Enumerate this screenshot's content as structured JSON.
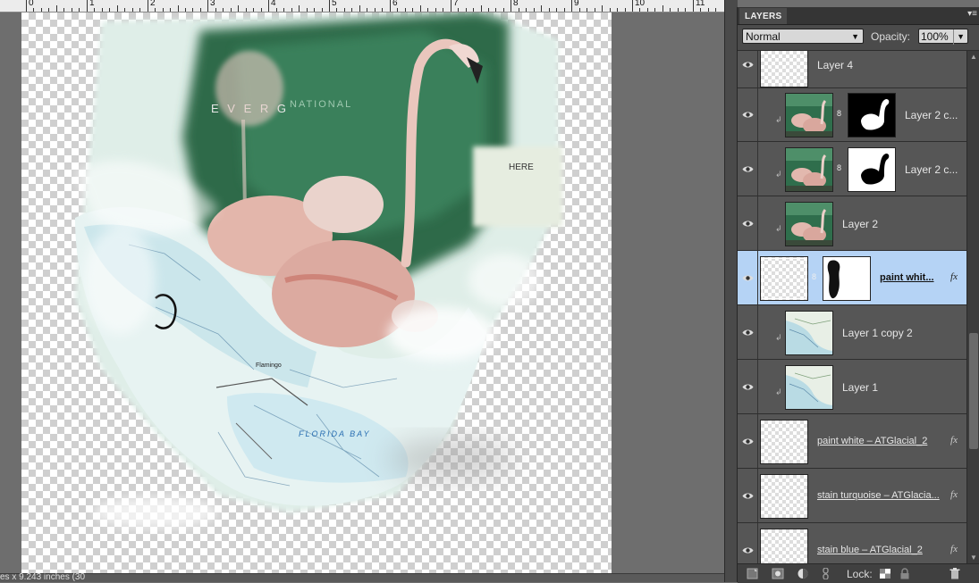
{
  "ruler": {
    "numbers": [
      "0",
      "1",
      "2",
      "3",
      "4",
      "5",
      "6",
      "7",
      "8",
      "9",
      "10",
      "11"
    ]
  },
  "status": {
    "text": "es x 9.243 inches (30"
  },
  "panel": {
    "tab_label": "LAYERS",
    "blend_mode": "Normal",
    "opacity_label": "Opacity:",
    "opacity_value": "100%",
    "lock_label": "Lock:"
  },
  "map_labels": {
    "everglades": "E V E R G",
    "national": "NATIONAL",
    "here": "HERE",
    "florida_bay": "FLORIDA BAY",
    "flamingo": "Flamingo"
  },
  "layers": [
    {
      "name": "Layer 4",
      "thumb": "blank",
      "mask": "",
      "clipped": false,
      "fx": false,
      "selected": false
    },
    {
      "name": "Layer 2 c...",
      "thumb": "flamingo",
      "mask": "black",
      "clipped": true,
      "fx": false,
      "selected": false
    },
    {
      "name": "Layer 2 c...",
      "thumb": "flamingo",
      "mask": "white",
      "clipped": true,
      "fx": false,
      "selected": false
    },
    {
      "name": "Layer 2",
      "thumb": "flamingo",
      "mask": "",
      "clipped": true,
      "fx": false,
      "selected": false
    },
    {
      "name": "paint whit...",
      "thumb": "blank",
      "mask": "stroke",
      "clipped": false,
      "fx": true,
      "selected": true
    },
    {
      "name": "Layer 1 copy 2",
      "thumb": "map",
      "mask": "",
      "clipped": true,
      "fx": false,
      "selected": false
    },
    {
      "name": "Layer 1",
      "thumb": "map",
      "mask": "",
      "clipped": true,
      "fx": false,
      "selected": false
    },
    {
      "name": "paint white – ATGlacial_2",
      "thumb": "blank",
      "mask": "",
      "clipped": false,
      "fx": true,
      "selected": false
    },
    {
      "name": "stain turquoise – ATGlacia...",
      "thumb": "blank",
      "mask": "",
      "clipped": false,
      "fx": true,
      "selected": false
    },
    {
      "name": "stain blue – ATGlacial_2",
      "thumb": "blank",
      "mask": "",
      "clipped": false,
      "fx": true,
      "selected": false
    }
  ],
  "icons": {
    "eye": "eye-icon",
    "link": "link-icon",
    "fx": "fx-icon",
    "fx_glyph": "fx",
    "clip_glyph": "↲",
    "trash": "trash-icon",
    "lock": "lock-icon"
  },
  "colors": {
    "selected_row": "#b5d3f5",
    "panel_bg": "#4b4b4b",
    "workspace_bg": "#6e6e6e"
  }
}
